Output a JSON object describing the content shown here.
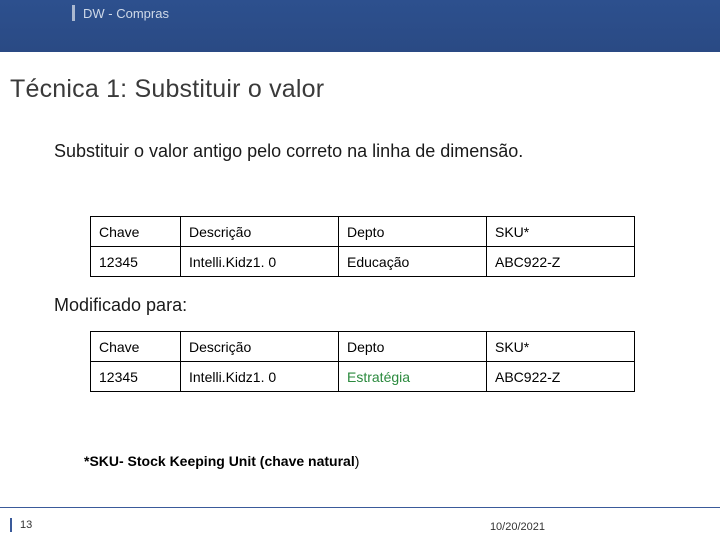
{
  "header": {
    "title": "DW - Compras"
  },
  "slide": {
    "title": "Técnica 1: Substituir o valor",
    "subtitle": "Substituir o valor antigo pelo correto na linha de dimensão.",
    "modified_label": "Modificado para:",
    "footnote_bold": "*SKU- Stock Keeping Unit (chave natural",
    "footnote_rest": ")"
  },
  "table_before": {
    "headers": [
      "Chave",
      "Descrição",
      "Depto",
      "SKU*"
    ],
    "row": [
      "12345",
      "Intelli.Kidz1. 0",
      "Educação",
      "ABC922-Z"
    ]
  },
  "table_after": {
    "headers": [
      "Chave",
      "Descrição",
      "Depto",
      "SKU*"
    ],
    "row": [
      "12345",
      "Intelli.Kidz1. 0",
      "Estratégia",
      "ABC922-Z"
    ]
  },
  "footer": {
    "page": "13",
    "date": "10/20/2021"
  }
}
